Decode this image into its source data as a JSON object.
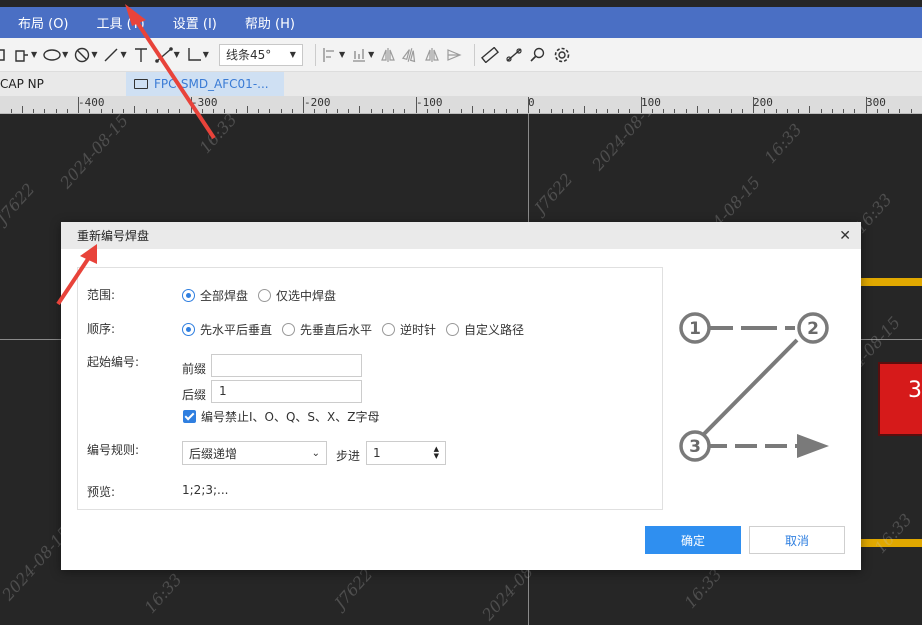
{
  "menu": [
    {
      "label": "布局 (O)"
    },
    {
      "label": "工具 (T)"
    },
    {
      "label": "设置 (I)"
    },
    {
      "label": "帮助 (H)"
    }
  ],
  "toolbar": {
    "line_mode": "线条45°",
    "icons": [
      "rectangle-icon",
      "polyline-icon",
      "ellipse-icon",
      "circle-slash-icon",
      "arc-icon",
      "text-icon",
      "dimension-icon",
      "angle-icon",
      "align-icon",
      "distribute-icon",
      "flip-icon",
      "mirror-icon",
      "arrow-icon",
      "ruler-icon",
      "measure-icon",
      "search-icon",
      "gear-icon"
    ]
  },
  "tabs": [
    {
      "label": "CAP NP"
    },
    {
      "label": "FPC-SMD_AFC01-..."
    }
  ],
  "ruler": {
    "labels": [
      "-400",
      "-300",
      "-200",
      "-100",
      "0",
      "100",
      "200",
      "300"
    ]
  },
  "canvas": {
    "watermark_date": "2024-08-15",
    "watermark_time": "16:33",
    "watermark_id": "J7622",
    "pad_label": "3"
  },
  "dialog": {
    "title": "重新编号焊盘",
    "range_label": "范围:",
    "range_options": [
      "全部焊盘",
      "仅选中焊盘"
    ],
    "order_label": "顺序:",
    "order_options": [
      "先水平后垂直",
      "先垂直后水平",
      "逆时针",
      "自定义路径"
    ],
    "start_label": "起始编号:",
    "prefix_label": "前缀",
    "prefix_value": "",
    "suffix_label": "后缀",
    "suffix_value": "1",
    "exclude_label": "编号禁止I、O、Q、S、X、Z字母",
    "rule_label": "编号规则:",
    "rule_value": "后缀递增",
    "step_label": "步进",
    "step_value": "1",
    "preview_label": "预览:",
    "preview_value": "1;2;3;...",
    "ok_label": "确定",
    "cancel_label": "取消",
    "diagram_numbers": [
      "1",
      "2",
      "3"
    ]
  },
  "colors": {
    "menubar": "#4a6fc4",
    "primary": "#2f8ff0",
    "canvas": "#262626",
    "pad": "#d61a1a",
    "trace": "#e0a800",
    "annotation_arrow": "#e8433a"
  }
}
